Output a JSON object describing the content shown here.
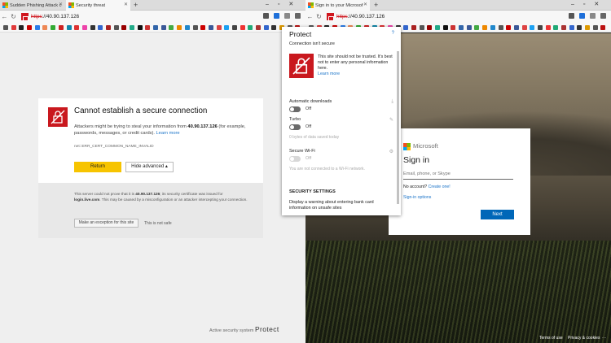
{
  "left_window": {
    "tabs": [
      {
        "title": "Sudden Phishing Attack c"
      },
      {
        "title": "Security threat"
      }
    ],
    "address": {
      "scheme": "https",
      "url_rest": "://40.90.137.126"
    },
    "card": {
      "title": "Cannot establish a secure connection",
      "text_pre": "Attackers might be trying to steal your information from ",
      "ip": "40.90.137.126",
      "text_post": " (for example, passwords, messages, or credit cards). ",
      "learn_more": "Learn more",
      "error_code": "net::ERR_CERT_COMMON_NAME_INVALID",
      "return_label": "Return",
      "hide_advanced_label": "Hide advanced ▴"
    },
    "details": {
      "text_pre": "This server could not prove that it is ",
      "ip": "40.90.137.126",
      "text_mid": "; its security certificate was issued for ",
      "issued_for": "login.live.com",
      "text_post": ". This may be caused by a misconfiguration or an attacker intercepting your connection.",
      "exception_label": "Make an exception for this site",
      "not_safe": "This is not safe"
    },
    "footer": {
      "prefix": "Active security system",
      "brand": "Protect"
    }
  },
  "right_window": {
    "tabs": [
      {
        "title": "Sign in to your Microsof"
      }
    ],
    "address": {
      "scheme": "https",
      "url_rest": "://40.90.137.126"
    },
    "signin": {
      "brand": "Microsoft",
      "title": "Sign in",
      "placeholder": "Email, phone, or Skype",
      "no_account": "No account? ",
      "create_one": "Create one!",
      "signin_options": "Sign-in options",
      "next_label": "Next"
    },
    "footer": {
      "terms": "Terms of use",
      "privacy": "Privacy & cookies",
      "more": "···"
    }
  },
  "protect_popup": {
    "title": "Protect",
    "help": "?",
    "status": "Connection isn't secure",
    "warning_text": "This site should not be trusted. It's best not to enter any personal information here.",
    "learn_more": "Learn more",
    "auto_downloads": {
      "label": "Automatic downloads",
      "value": "Off"
    },
    "turbo": {
      "label": "Turbo",
      "value": "Off",
      "note": "0 bytes of data saved today"
    },
    "wifi": {
      "label": "Secure Wi-Fi",
      "value": "Off",
      "note": "You are not connected to a Wi-Fi network."
    },
    "security_settings": "SECURITY SETTINGS",
    "security_desc": "Display a warning about entering bank card information on unsafe sites"
  },
  "colors": {
    "danger": "#c9181e",
    "accent": "#f7c400",
    "ms_blue": "#0067b8",
    "link": "#1a73c8"
  }
}
